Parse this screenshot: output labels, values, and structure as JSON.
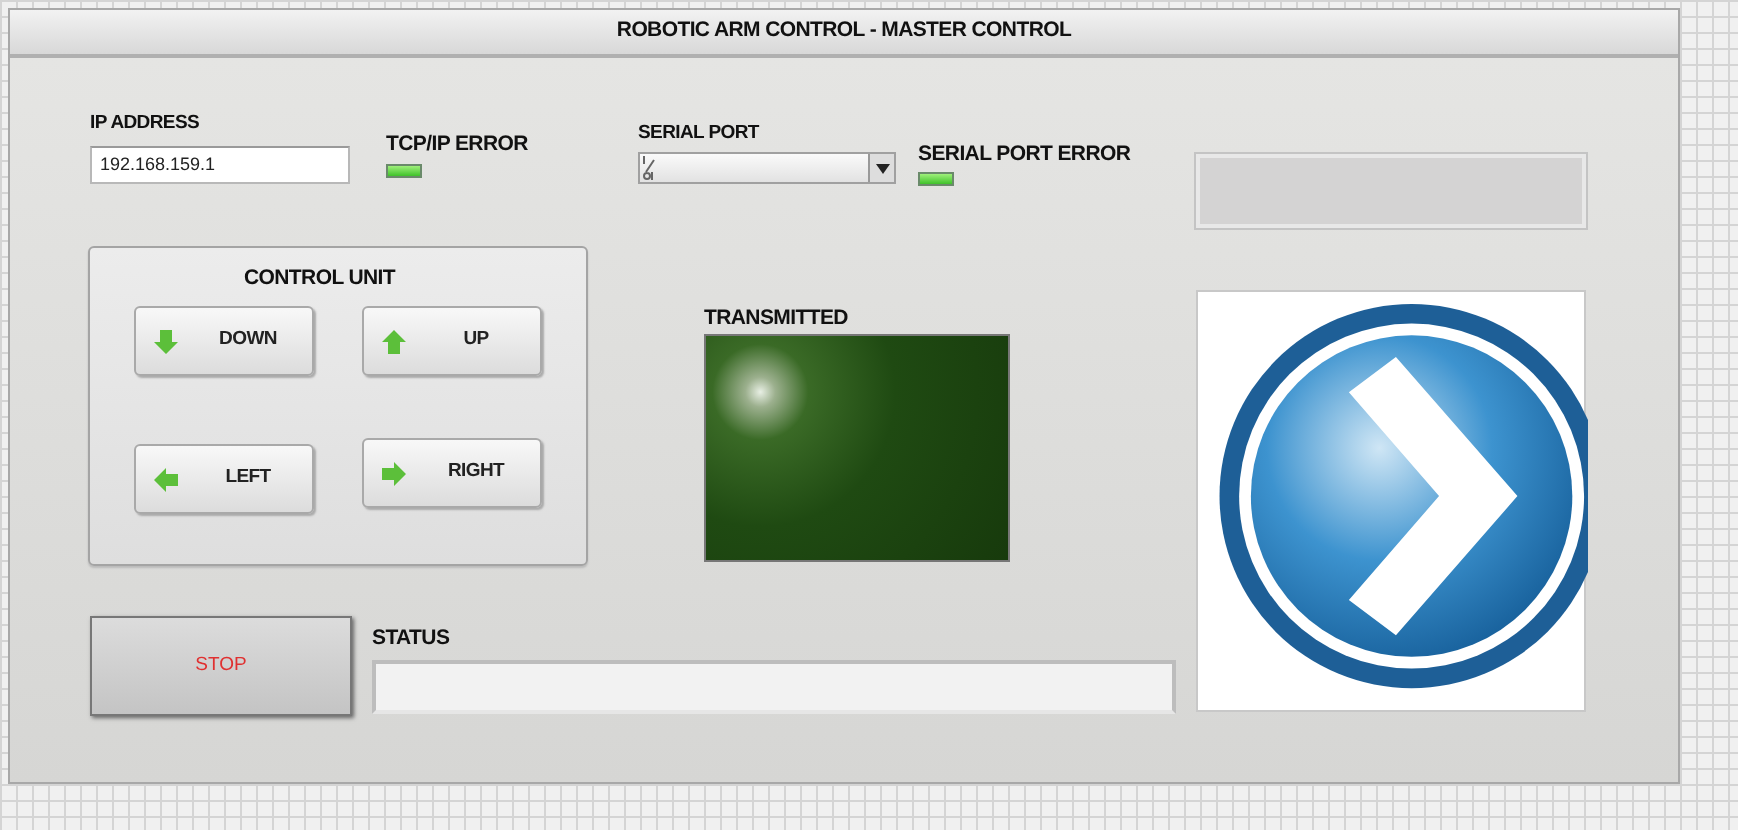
{
  "window": {
    "title": "ROBOTIC ARM CONTROL - MASTER CONTROL"
  },
  "ip_address": {
    "label": "IP ADDRESS",
    "value": "192.168.159.1"
  },
  "tcp_ip_error": {
    "label": "TCP/IP ERROR",
    "on": true
  },
  "serial_port": {
    "label": "SERIAL PORT"
  },
  "serial_port_error": {
    "label": "SERIAL PORT ERROR",
    "on": true
  },
  "control_unit": {
    "title": "CONTROL UNIT",
    "buttons": [
      {
        "label": "DOWN",
        "kind": "down"
      },
      {
        "label": "UP",
        "kind": "up"
      },
      {
        "label": "LEFT",
        "kind": "left"
      },
      {
        "label": "RIGHT",
        "kind": "right"
      }
    ]
  },
  "transmitted": {
    "label": "TRANSMITTED",
    "on": false
  },
  "stop_button": {
    "label": "STOP"
  },
  "status": {
    "label": "STATUS"
  }
}
